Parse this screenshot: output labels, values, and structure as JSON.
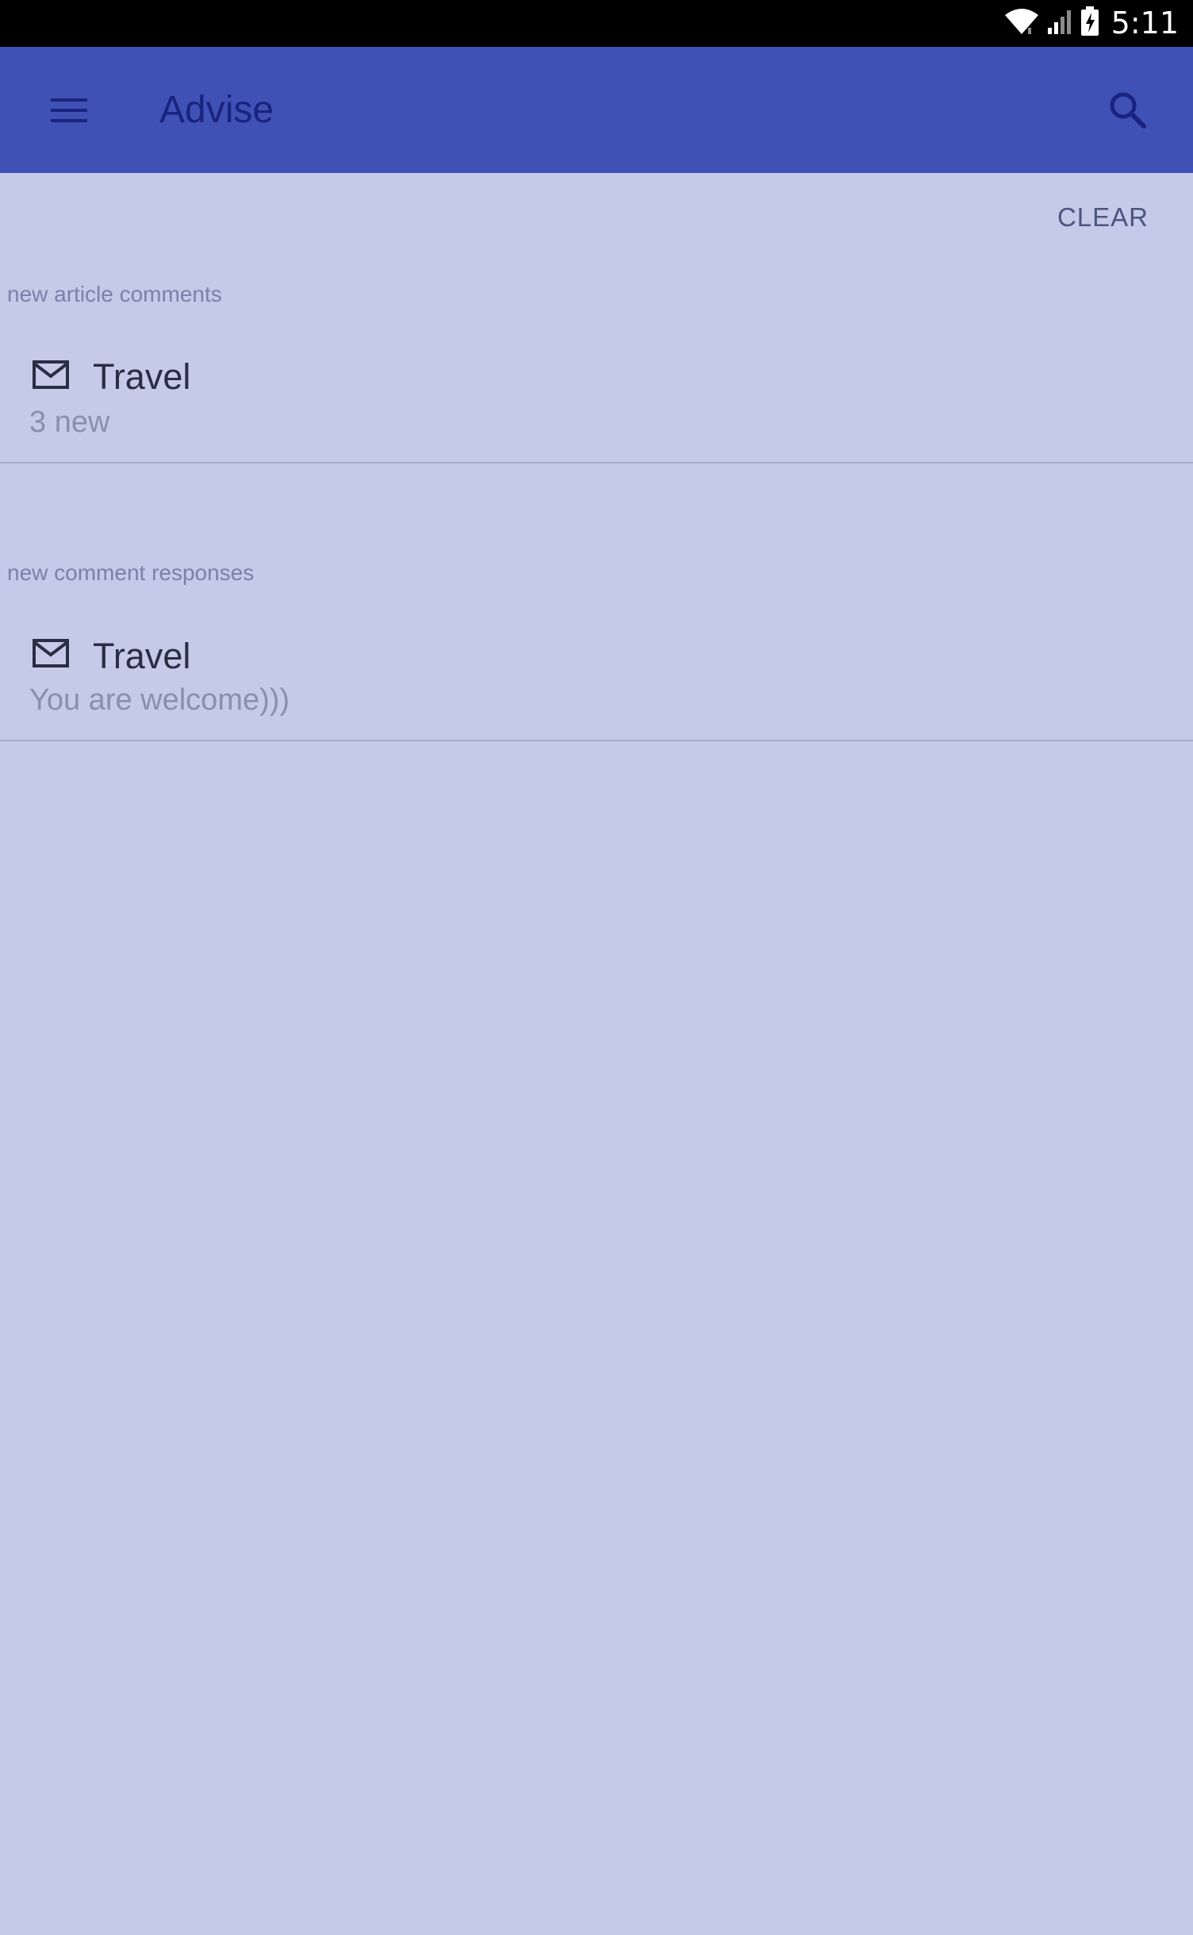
{
  "status_bar": {
    "time": "5:11",
    "icons": [
      "wifi-icon",
      "signal-icon",
      "battery-charging-icon"
    ]
  },
  "app_bar": {
    "title": "Advise",
    "menu_icon": "menu-icon",
    "search_icon": "search-icon",
    "color": "#3f51b5"
  },
  "actions": {
    "clear_label": "CLEAR"
  },
  "sections": [
    {
      "header": "new article comments",
      "items": [
        {
          "icon": "mail-icon",
          "title": "Travel",
          "subtitle": "3 new"
        }
      ]
    },
    {
      "header": "new comment responses",
      "items": [
        {
          "icon": "mail-icon",
          "title": "Travel",
          "subtitle": "You are welcome)))"
        }
      ]
    }
  ],
  "colors": {
    "background": "#c5cae9",
    "status_bar": "#000000",
    "title_text": "#1a237e"
  }
}
